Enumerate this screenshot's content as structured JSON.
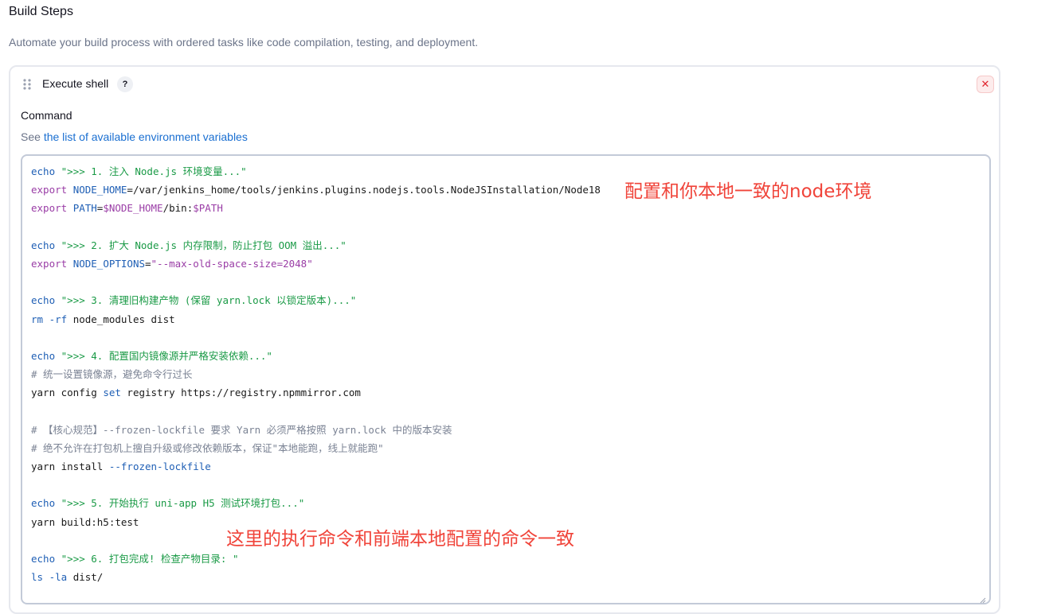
{
  "section": {
    "title": "Build Steps",
    "description": "Automate your build process with ordered tasks like code compilation, testing, and deployment."
  },
  "step": {
    "title": "Execute shell",
    "help_label": "?",
    "close_label": "✕",
    "field_label": "Command",
    "env_prefix": "See ",
    "env_link": "the list of available environment variables"
  },
  "code": {
    "lines": [
      [
        {
          "t": "echo ",
          "c": "kw"
        },
        {
          "t": "\">>> 1. 注入 Node.js 环境变量...\"",
          "c": "str"
        }
      ],
      [
        {
          "t": "export ",
          "c": "export"
        },
        {
          "t": "NODE_HOME",
          "c": "var"
        },
        {
          "t": "=/var/jenkins_home/tools/jenkins.plugins.nodejs.tools.NodeJSInstallation/Node18",
          "c": "plain"
        }
      ],
      [
        {
          "t": "export ",
          "c": "export"
        },
        {
          "t": "PATH",
          "c": "var"
        },
        {
          "t": "=",
          "c": "plain"
        },
        {
          "t": "$NODE_HOME",
          "c": "export"
        },
        {
          "t": "/bin:",
          "c": "plain"
        },
        {
          "t": "$PATH",
          "c": "export"
        }
      ],
      [],
      [
        {
          "t": "echo ",
          "c": "kw"
        },
        {
          "t": "\">>> 2. 扩大 Node.js 内存限制，防止打包 OOM 溢出...\"",
          "c": "str"
        }
      ],
      [
        {
          "t": "export ",
          "c": "export"
        },
        {
          "t": "NODE_OPTIONS",
          "c": "var"
        },
        {
          "t": "=",
          "c": "plain"
        },
        {
          "t": "\"--max-old-space-size=2048\"",
          "c": "export"
        }
      ],
      [],
      [
        {
          "t": "echo ",
          "c": "kw"
        },
        {
          "t": "\">>> 3. 清理旧构建产物 (保留 yarn.lock 以锁定版本)...\"",
          "c": "str"
        }
      ],
      [
        {
          "t": "rm ",
          "c": "kw"
        },
        {
          "t": "-rf ",
          "c": "kw"
        },
        {
          "t": "node_modules dist",
          "c": "plain"
        }
      ],
      [],
      [
        {
          "t": "echo ",
          "c": "kw"
        },
        {
          "t": "\">>> 4. 配置国内镜像源并严格安装依赖...\"",
          "c": "str"
        }
      ],
      [
        {
          "t": "# 统一设置镜像源，避免命令行过长",
          "c": "comment"
        }
      ],
      [
        {
          "t": "yarn config ",
          "c": "plain"
        },
        {
          "t": "set ",
          "c": "kw"
        },
        {
          "t": "registry https://registry.npmmirror.com",
          "c": "plain"
        }
      ],
      [],
      [
        {
          "t": "# 【核心规范】--frozen-lockfile 要求 Yarn 必须严格按照 yarn.lock 中的版本安装",
          "c": "comment"
        }
      ],
      [
        {
          "t": "# 绝不允许在打包机上擅自升级或修改依赖版本，保证\"本地能跑，线上就能跑\"",
          "c": "comment"
        }
      ],
      [
        {
          "t": "yarn install ",
          "c": "plain"
        },
        {
          "t": "--frozen-lockfile",
          "c": "kw"
        }
      ],
      [],
      [
        {
          "t": "echo ",
          "c": "kw"
        },
        {
          "t": "\">>> 5. 开始执行 uni-app H5 测试环境打包...\"",
          "c": "str"
        }
      ],
      [
        {
          "t": "yarn build:h5:test",
          "c": "plain"
        }
      ],
      [],
      [
        {
          "t": "echo ",
          "c": "kw"
        },
        {
          "t": "\">>> 6. 打包完成! 检查产物目录: \"",
          "c": "str"
        }
      ],
      [
        {
          "t": "ls ",
          "c": "kw"
        },
        {
          "t": "-la ",
          "c": "kw"
        },
        {
          "t": "dist/",
          "c": "plain"
        }
      ]
    ]
  },
  "annotations": {
    "node_env": "配置和你本地一致的node环境",
    "build_cmd": "这里的执行命令和前端本地配置的命令一致"
  },
  "colors": {
    "annotation": "#f0443a",
    "keyword": "#1f5fb5",
    "string": "#1a9a46",
    "export": "#9a3da6",
    "comment": "#7b8394",
    "link": "#1a6fd1",
    "close": "#e0252e"
  },
  "icons": {
    "drag_handle": "drag-handle-icon",
    "help": "help-icon",
    "close": "close-icon",
    "resize": "resize-grip-icon"
  }
}
